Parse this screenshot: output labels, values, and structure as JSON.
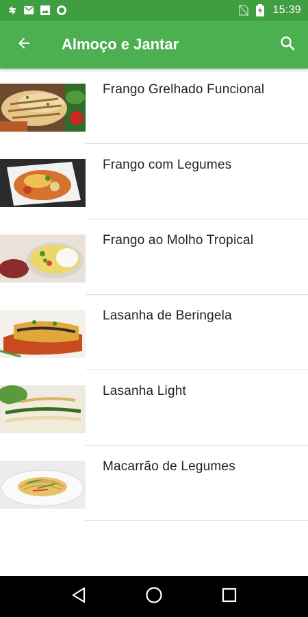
{
  "status_bar": {
    "time": "15:39",
    "left_icons": [
      "sync-icon",
      "mail-icon",
      "image-icon",
      "circle-icon"
    ],
    "right_icons": [
      "no-sim-icon",
      "battery-charging-icon"
    ]
  },
  "app_bar": {
    "title": "Almoço e Jantar",
    "back_icon": "arrow-back-icon",
    "search_icon": "search-icon",
    "color": "#4caf50",
    "status_color": "#3f9e3f"
  },
  "recipes": [
    {
      "title": "Frango Grelhado Funcional",
      "image": "grilled-chicken-image"
    },
    {
      "title": "Frango com Legumes",
      "image": "chicken-vegetables-image"
    },
    {
      "title": "Frango ao Molho Tropical",
      "image": "chicken-tropical-sauce-image"
    },
    {
      "title": "Lasanha de Beringela",
      "image": "eggplant-lasagna-image"
    },
    {
      "title": "Lasanha Light",
      "image": "light-lasagna-image"
    },
    {
      "title": "Macarrão de Legumes",
      "image": "vegetable-pasta-image"
    }
  ],
  "nav_bar": {
    "back_icon": "nav-back-icon",
    "home_icon": "nav-home-icon",
    "recents_icon": "nav-recents-icon"
  }
}
